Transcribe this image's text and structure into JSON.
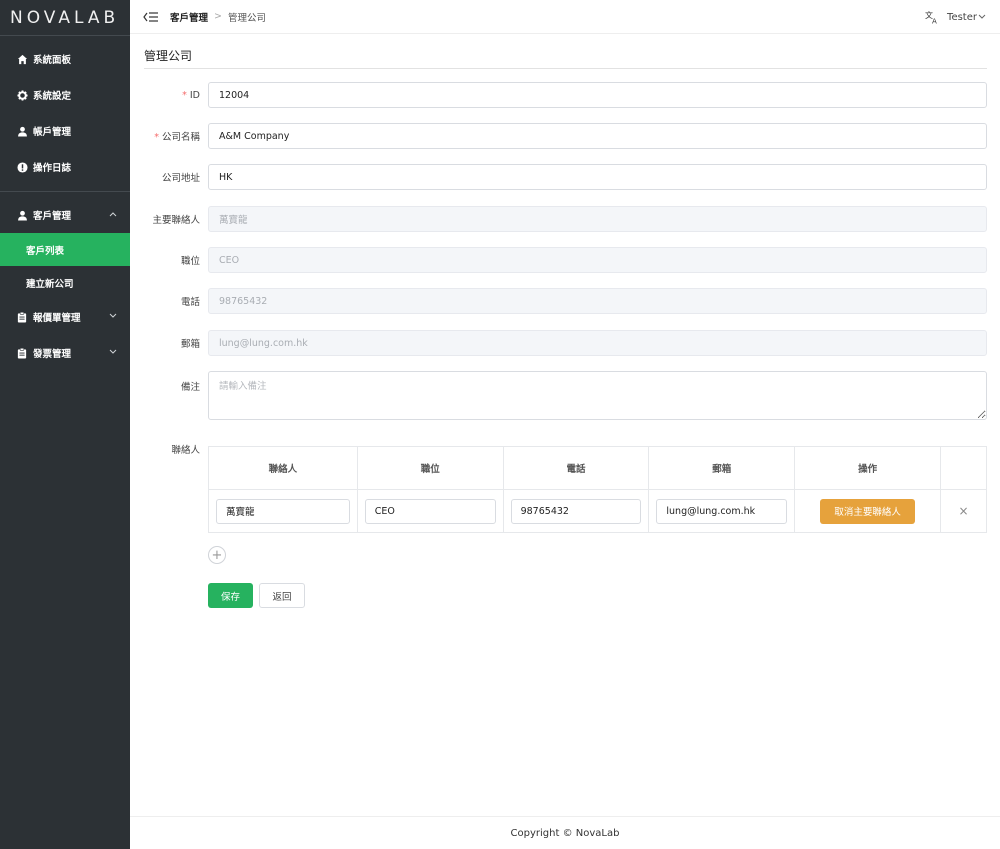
{
  "app": {
    "logo": "NOVALAB"
  },
  "sidebar": {
    "items": [
      {
        "label": "系統面板",
        "icon": "home-icon"
      },
      {
        "label": "系統設定",
        "icon": "gear-icon"
      },
      {
        "label": "帳戶管理",
        "icon": "user-icon"
      },
      {
        "label": "操作日誌",
        "icon": "info-circle-icon"
      }
    ],
    "groups": [
      {
        "label": "客戶管理",
        "icon": "user-icon",
        "expanded": true,
        "children": [
          {
            "label": "客戶列表",
            "active": true
          },
          {
            "label": "建立新公司",
            "active": false
          }
        ]
      },
      {
        "label": "報價單管理",
        "icon": "clipboard-icon",
        "expanded": false
      },
      {
        "label": "發票管理",
        "icon": "clipboard-icon",
        "expanded": false
      }
    ]
  },
  "header": {
    "breadcrumb": {
      "parent": "客戶管理",
      "separator": ">",
      "current": "管理公司"
    },
    "user": "Tester"
  },
  "page": {
    "title": "管理公司"
  },
  "form": {
    "id": {
      "label": "ID",
      "value": "12004",
      "required": true
    },
    "company_name": {
      "label": "公司名稱",
      "value": "A&M Company",
      "required": true
    },
    "company_address": {
      "label": "公司地址",
      "value": "HK"
    },
    "primary_contact": {
      "label": "主要聯絡人",
      "value": "萬寶龍",
      "disabled": true
    },
    "position": {
      "label": "職位",
      "value": "CEO",
      "disabled": true
    },
    "phone": {
      "label": "電話",
      "value": "98765432",
      "disabled": true
    },
    "email": {
      "label": "郵箱",
      "value": "lung@lung.com.hk",
      "disabled": true
    },
    "remarks": {
      "label": "備注",
      "placeholder": "請輸入備注"
    }
  },
  "contacts": {
    "label": "聯絡人",
    "columns": [
      "聯絡人",
      "職位",
      "電話",
      "郵箱",
      "操作"
    ],
    "rows": [
      {
        "name": "萬寶龍",
        "position": "CEO",
        "phone": "98765432",
        "email": "lung@lung.com.hk",
        "action_label": "取消主要聯絡人",
        "remove": "×"
      }
    ],
    "add_symbol": "+"
  },
  "buttons": {
    "save": "保存",
    "back": "返回"
  },
  "footer": {
    "copyright": "Copyright © NovaLab"
  },
  "colors": {
    "sidebar_bg": "#2c3135",
    "accent_green": "#26b25f",
    "warning_orange": "#e6a23c",
    "required_red": "#f56c6c"
  }
}
